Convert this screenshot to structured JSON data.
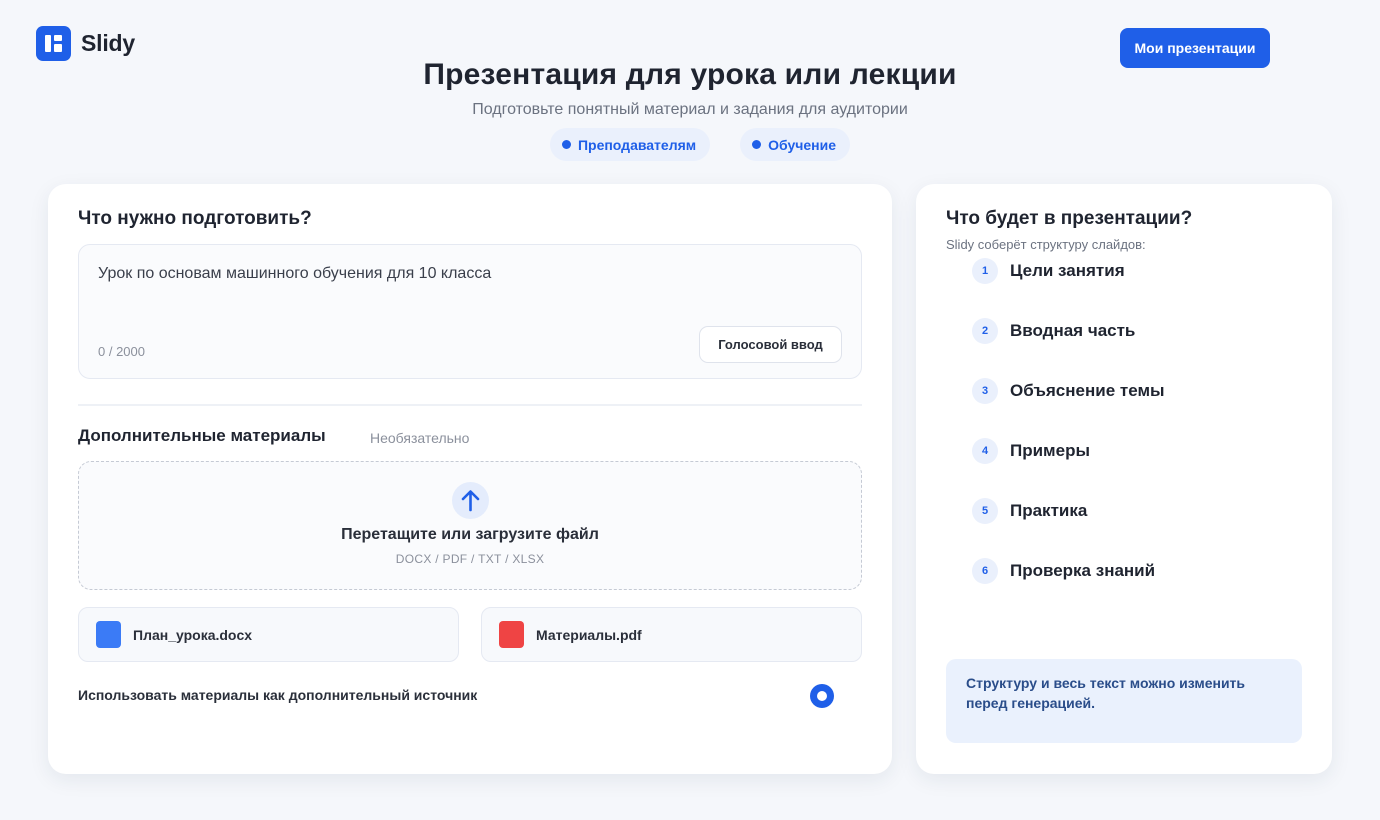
{
  "brand": {
    "name": "Slidy"
  },
  "header": {
    "my_presentations": "Мои презентации",
    "title": "Презентация для урока или лекции",
    "subtitle": "Подготовьте понятный материал и задания для аудитории",
    "tags": [
      "Преподавателям",
      "Обучение"
    ]
  },
  "form": {
    "prompt_heading": "Что нужно подготовить?",
    "prompt_value": "Урок по основам машинного обучения для 10 класса",
    "char_counter": "0 / 2000",
    "voice_input": "Голосовой ввод",
    "materials_heading": "Дополнительные материалы",
    "materials_optional": "Необязательно",
    "dropzone_title": "Перетащите или загрузите файл",
    "dropzone_formats": "DOCX / PDF / TXT / XLSX",
    "files": [
      {
        "name": "План_урока.docx",
        "color": "#3b7bf6"
      },
      {
        "name": "Материалы.pdf",
        "color": "#ef4444"
      }
    ],
    "use_materials_label": "Использовать материалы как дополнительный источник",
    "use_materials_selected": true
  },
  "outline": {
    "heading": "Что будет в презентации?",
    "subheading": "Slidy соберёт структуру слайдов:",
    "steps": [
      {
        "num": "1",
        "label": "Цели занятия"
      },
      {
        "num": "2",
        "label": "Вводная часть"
      },
      {
        "num": "3",
        "label": "Объяснение темы"
      },
      {
        "num": "4",
        "label": "Примеры"
      },
      {
        "num": "5",
        "label": "Практика"
      },
      {
        "num": "6",
        "label": "Проверка знаний"
      }
    ],
    "note": "Структуру и весь текст можно изменить перед генерацией."
  },
  "colors": {
    "accent": "#1f5fe8",
    "background": "#f5f7fb"
  }
}
